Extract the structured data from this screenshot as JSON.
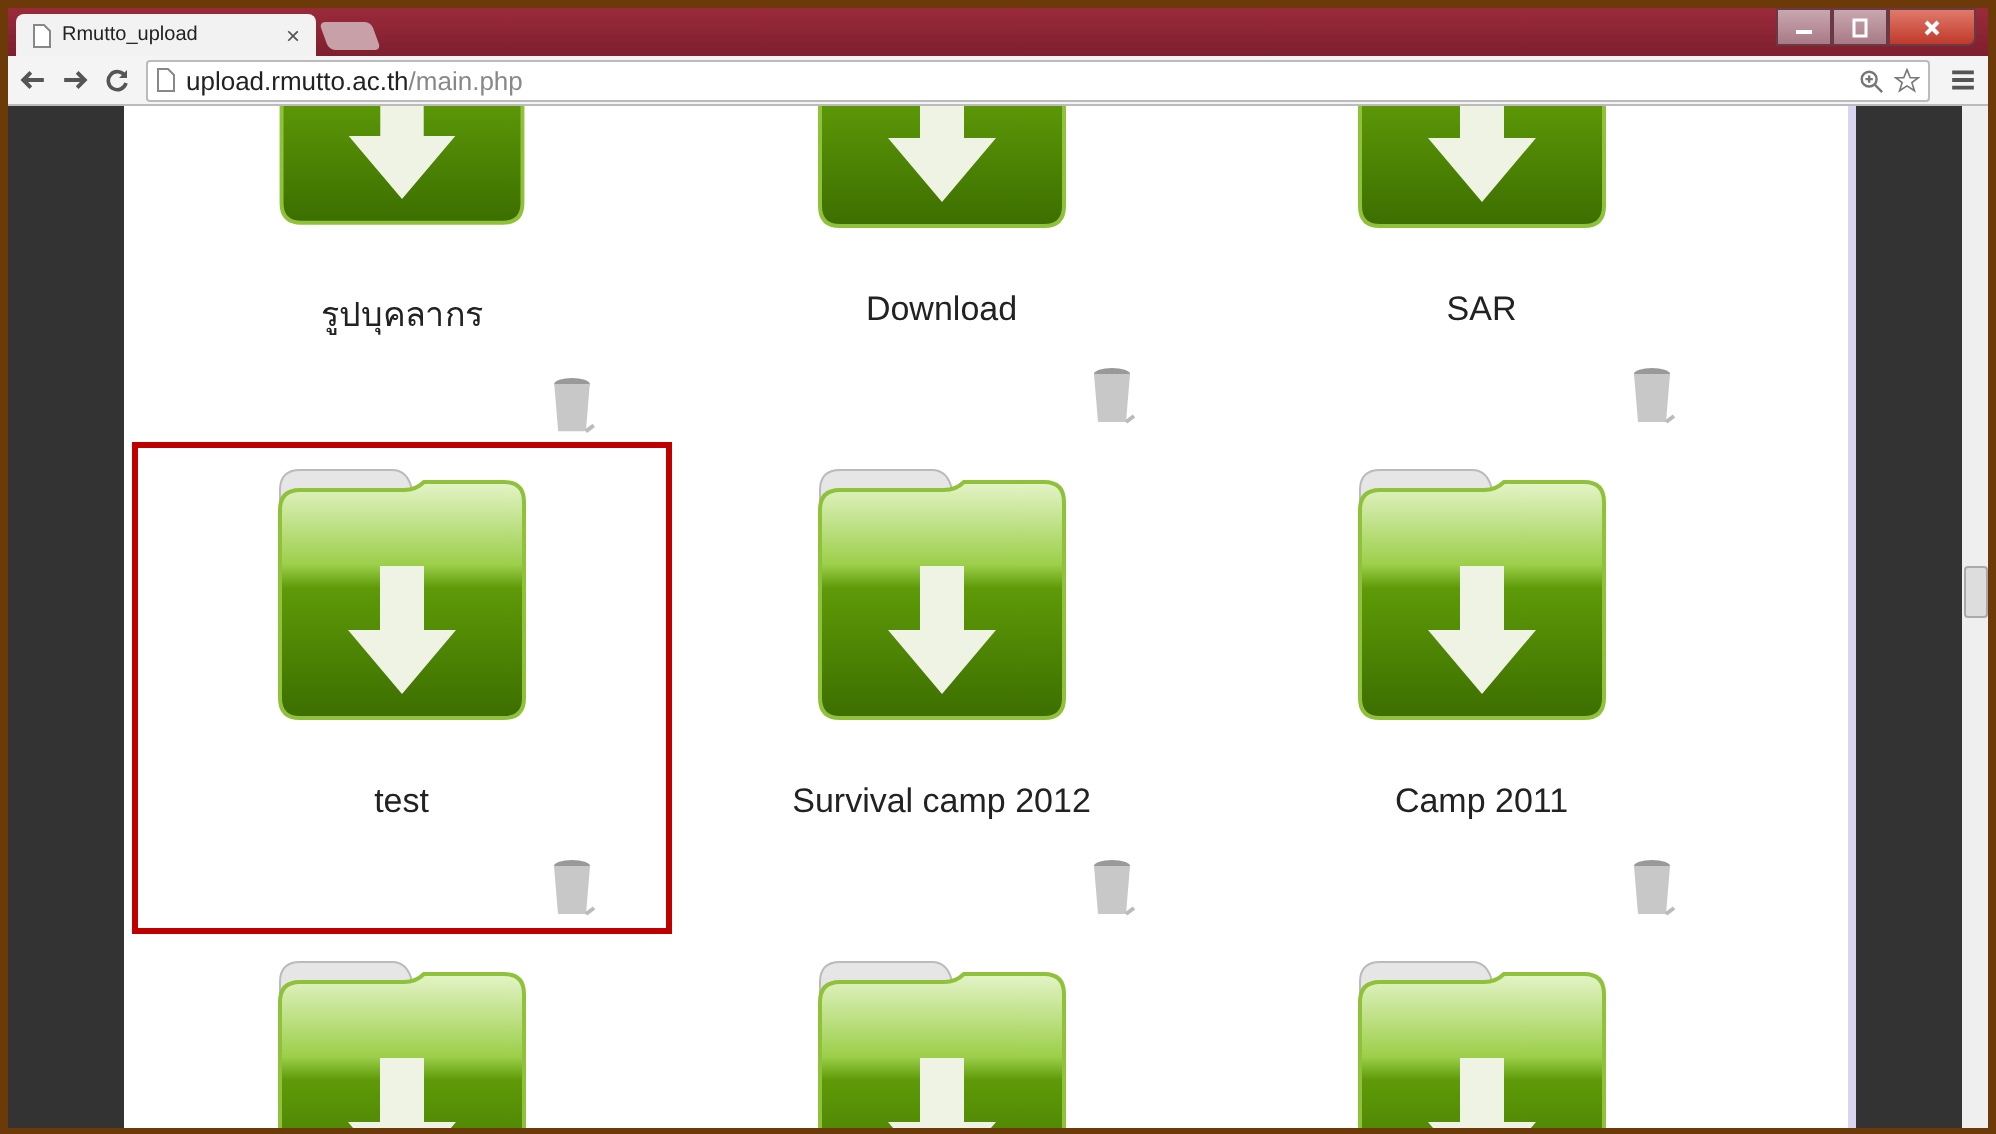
{
  "browser": {
    "tab": {
      "title": "Rmutto_upload",
      "close": "×"
    },
    "address": {
      "host": "upload.rmutto.ac.th",
      "path": "/main.php"
    }
  },
  "folders": [
    {
      "name": "รูปบุคลากร",
      "selected": false
    },
    {
      "name": "Download",
      "selected": false
    },
    {
      "name": "SAR",
      "selected": false
    },
    {
      "name": "test",
      "selected": true
    },
    {
      "name": "Survival camp 2012",
      "selected": false
    },
    {
      "name": "Camp 2011",
      "selected": false
    },
    {
      "selected": false
    },
    {
      "selected": false
    },
    {
      "selected": false
    }
  ]
}
